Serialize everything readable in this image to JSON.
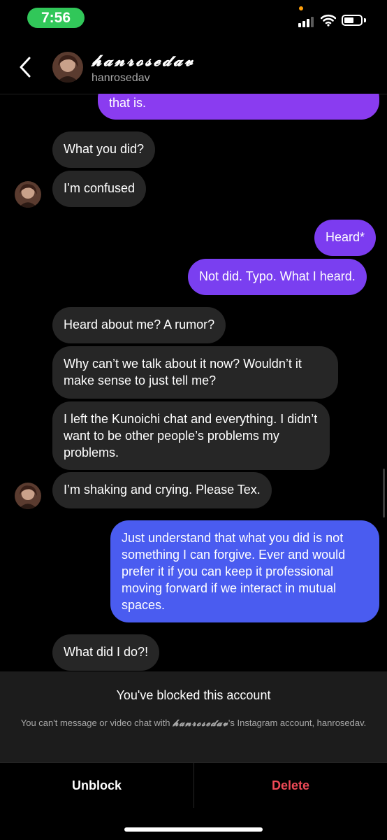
{
  "status_bar": {
    "time": "7:56"
  },
  "header": {
    "display_name": "𝓱𝓪𝓷𝓻𝓸𝓼𝓮𝓭𝓪𝓿",
    "username": "hanrosedav"
  },
  "messages": [
    {
      "from": "me",
      "text": "that is."
    },
    {
      "from": "them",
      "text": "What you did?"
    },
    {
      "from": "them",
      "text": "I’m confused"
    },
    {
      "from": "me",
      "text": "Heard*"
    },
    {
      "from": "me",
      "text": "Not did. Typo. What I heard."
    },
    {
      "from": "them",
      "text": "Heard about me? A rumor?"
    },
    {
      "from": "them",
      "text": "Why can’t we talk about it now? Wouldn’t it make sense to just tell me?"
    },
    {
      "from": "them",
      "text": "I left the Kunoichi chat and everything. I didn’t want to be other people’s problems my problems."
    },
    {
      "from": "them",
      "text": "I’m shaking and crying. Please Tex."
    },
    {
      "from": "me",
      "text": "Just understand that what you did is not something I can forgive. Ever and would prefer it if you can keep it professional moving forward if we interact in mutual spaces."
    },
    {
      "from": "them",
      "text": "What did I do?!"
    }
  ],
  "blocked": {
    "title": "You've blocked this account",
    "desc_prefix": "You can't message or video chat with ",
    "desc_name": "𝓱𝓪𝓷𝓻𝓸𝓼𝓮𝓭𝓪𝓿",
    "desc_suffix": "'s Instagram account, hanrosedav."
  },
  "actions": {
    "unblock": "Unblock",
    "delete": "Delete"
  },
  "colors": {
    "accent_purple": "#8a3cf0",
    "accent_blue": "#4a5cf0",
    "incoming_bubble": "#262626",
    "delete_red": "#ed4956",
    "status_green": "#31c759"
  },
  "icons": [
    "back-icon",
    "wifi-icon",
    "battery-icon",
    "signal-icon"
  ]
}
